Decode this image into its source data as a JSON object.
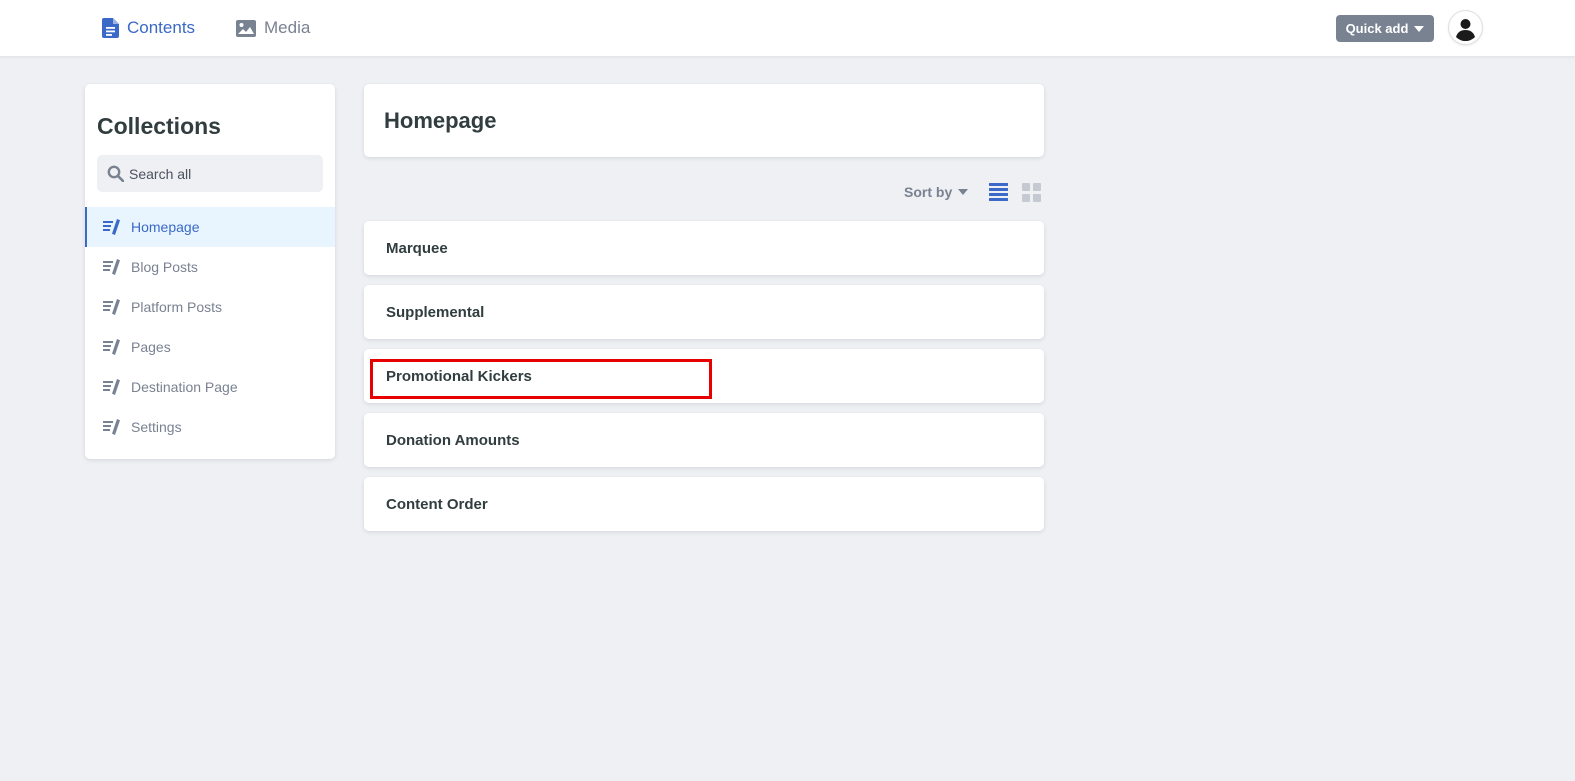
{
  "topbar": {
    "contents_label": "Contents",
    "media_label": "Media",
    "quick_add_label": "Quick add",
    "accent": "#3a69c7",
    "button_color": "#798291"
  },
  "sidebar": {
    "title": "Collections",
    "search_placeholder": "Search all",
    "items": [
      {
        "label": "Homepage",
        "active": true
      },
      {
        "label": "Blog Posts"
      },
      {
        "label": "Platform Posts"
      },
      {
        "label": "Pages"
      },
      {
        "label": "Destination Page"
      },
      {
        "label": "Settings"
      }
    ]
  },
  "main": {
    "title": "Homepage",
    "sort_label": "Sort by",
    "entries": [
      {
        "label": "Marquee"
      },
      {
        "label": "Supplemental"
      },
      {
        "label": "Promotional Kickers",
        "highlighted": true
      },
      {
        "label": "Donation Amounts"
      },
      {
        "label": "Content Order"
      }
    ]
  },
  "icons": {
    "contents": "document-icon",
    "media": "image-icon",
    "collection": "edit-list-icon",
    "search": "search-icon",
    "avatar": "user-icon",
    "view_list": "list-view-icon",
    "view_grid": "grid-view-icon"
  },
  "highlight_color": "#e60000"
}
